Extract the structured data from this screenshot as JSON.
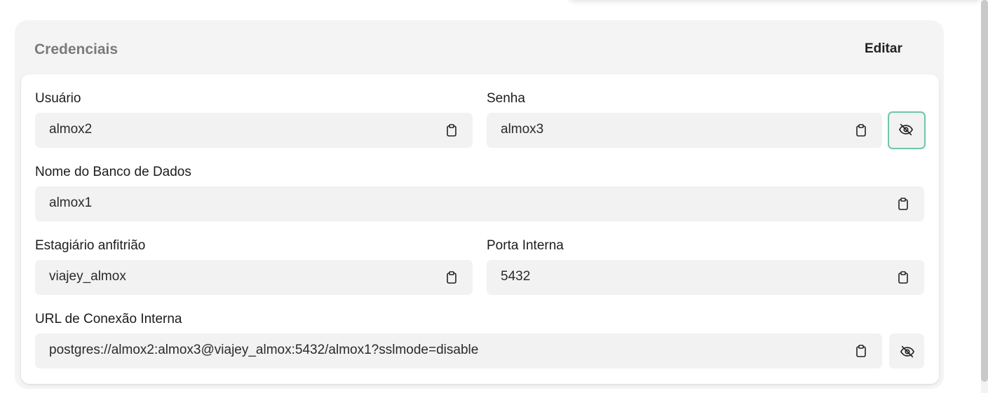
{
  "card": {
    "title": "Credenciais",
    "edit_label": "Editar"
  },
  "fields": {
    "user": {
      "label": "Usuário",
      "value": "almox2"
    },
    "password": {
      "label": "Senha",
      "value": "almox3"
    },
    "database": {
      "label": "Nome do Banco de Dados",
      "value": "almox1"
    },
    "host": {
      "label": "Estagiário anfitrião",
      "value": "viajey_almox"
    },
    "port": {
      "label": "Porta Interna",
      "value": "5432"
    },
    "url": {
      "label": "URL de Conexão Interna",
      "value": "postgres://almox2:almox3@viajey_almox:5432/almox1?sslmode=disable"
    }
  },
  "icons": {
    "copy": "clipboard-icon",
    "visibility": "eye-off-icon"
  },
  "colors": {
    "focus_ring": "#6fc6a4",
    "card_bg": "#f4f4f4",
    "field_bg": "#f2f2f2"
  }
}
